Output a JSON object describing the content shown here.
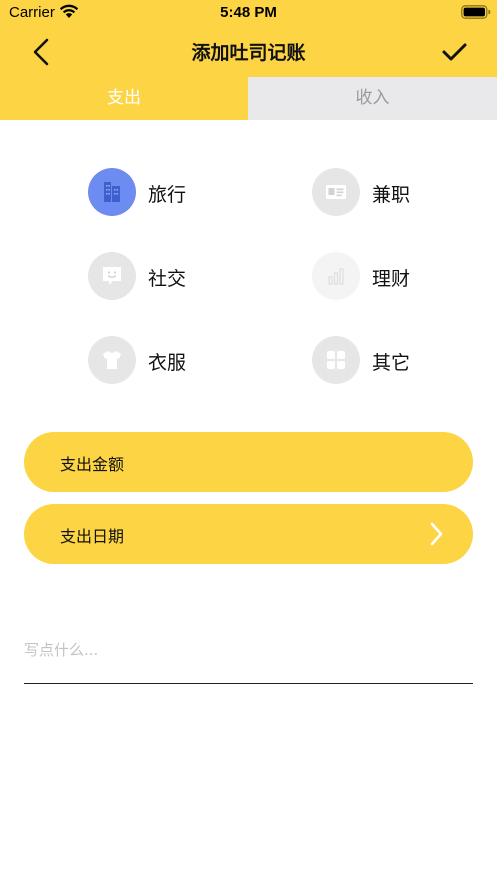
{
  "status_bar": {
    "carrier": "Carrier",
    "time": "5:48 PM"
  },
  "nav": {
    "title": "添加吐司记账",
    "back_icon": "chevron-left-icon",
    "confirm_icon": "checkmark-icon"
  },
  "tabs": [
    {
      "label": "支出",
      "selected": true
    },
    {
      "label": "收入",
      "selected": false
    }
  ],
  "categories": [
    {
      "label": "旅行",
      "icon": "building-icon",
      "selected": true
    },
    {
      "label": "兼职",
      "icon": "id-card-icon",
      "selected": false
    },
    {
      "label": "社交",
      "icon": "chat-face-icon",
      "selected": false
    },
    {
      "label": "理财",
      "icon": "bar-chart-icon",
      "selected": false
    },
    {
      "label": "衣服",
      "icon": "tshirt-icon",
      "selected": false
    },
    {
      "label": "其它",
      "icon": "grid-icon",
      "selected": false
    }
  ],
  "amount_field": {
    "label": "支出金额"
  },
  "date_field": {
    "label": "支出日期",
    "icon": "chevron-right-icon"
  },
  "note": {
    "placeholder": "写点什么...",
    "value": ""
  },
  "colors": {
    "accent": "#FDD544",
    "selected_icon": "#6D8CF2",
    "icon_bg": "#E6E6E6",
    "tab_inactive": "#E9E9EC"
  }
}
